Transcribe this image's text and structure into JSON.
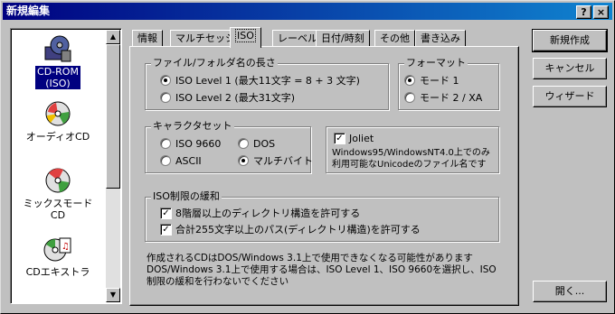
{
  "window": {
    "title": "新規編集"
  },
  "titlebar_buttons": {
    "help": "?",
    "close": "×"
  },
  "sidebar": {
    "items": [
      {
        "label": "CD-ROM\n(ISO)",
        "icon": "cd-rom-icon",
        "selected": true
      },
      {
        "label": "オーディオCD",
        "icon": "audio-cd-icon",
        "selected": false
      },
      {
        "label": "ミックスモード\nCD",
        "icon": "mixed-mode-cd-icon",
        "selected": false
      },
      {
        "label": "CDエキストラ",
        "icon": "cd-extra-icon",
        "selected": false
      }
    ]
  },
  "tabs": [
    {
      "label": "情報",
      "active": false
    },
    {
      "label": "マルチセッション",
      "active": false
    },
    {
      "label": "ISO",
      "active": true
    },
    {
      "label": "レーベル",
      "active": false
    },
    {
      "label": "日付/時刻",
      "active": false
    },
    {
      "label": "その他",
      "active": false
    },
    {
      "label": "書き込み",
      "active": false
    }
  ],
  "filename_group": {
    "title": "ファイル/フォルダ名の長さ",
    "options": [
      {
        "label": "ISO Level 1 (最大11文字 = 8 + 3 文字)",
        "checked": true
      },
      {
        "label": "ISO Level 2 (最大31文字)",
        "checked": false
      }
    ]
  },
  "format_group": {
    "title": "フォーマット",
    "options": [
      {
        "label": "モード 1",
        "checked": true
      },
      {
        "label": "モード 2 / XA",
        "checked": false
      }
    ]
  },
  "charset_group": {
    "title": "キャラクタセット",
    "options": [
      {
        "label": "ISO 9660",
        "checked": false
      },
      {
        "label": "DOS",
        "checked": false
      },
      {
        "label": "ASCII",
        "checked": false
      },
      {
        "label": "マルチバイト",
        "checked": true
      }
    ]
  },
  "joliet": {
    "label": "Joliet",
    "checked": true,
    "description_line1": "Windows95/WindowsNT4.0上でのみ",
    "description_line2": "利用可能なUnicodeのファイル名です"
  },
  "relax_group": {
    "title": "ISO制限の緩和",
    "options": [
      {
        "label": "8階層以上のディレクトリ構造を許可する",
        "checked": true
      },
      {
        "label": "合計255文字以上のパス(ディレクトリ構造)を許可する",
        "checked": true
      }
    ]
  },
  "notice": {
    "line1": "作成されるCDはDOS/Windows 3.1上で使用できなくなる可能性があります",
    "line2": "DOS/Windows 3.1上で使用する場合は、ISO Level 1、ISO 9660を選択し、ISO",
    "line3": "制限の緩和を行わないでください"
  },
  "buttons": {
    "new": "新規作成",
    "cancel": "キャンセル",
    "wizard": "ウィザード",
    "open": "開く..."
  }
}
